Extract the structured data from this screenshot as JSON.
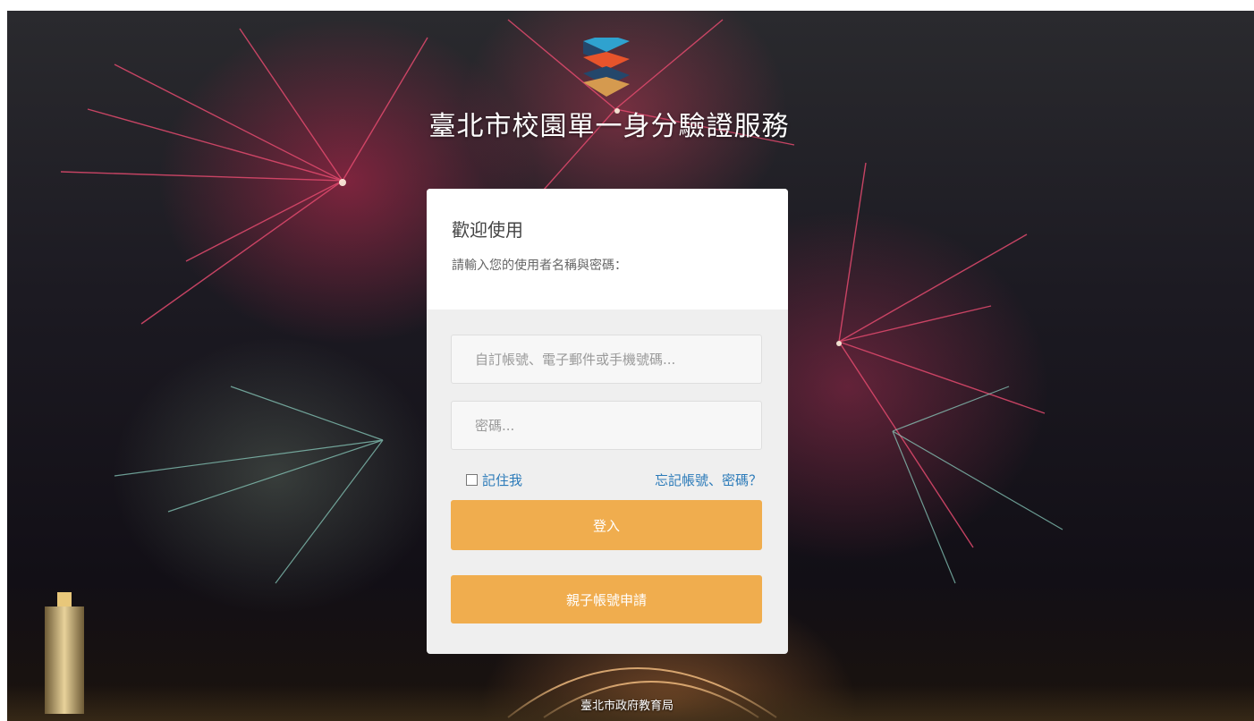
{
  "app": {
    "title": "臺北市校園單一身分驗證服務"
  },
  "login_card": {
    "heading": "歡迎使用",
    "subheading": "請輸入您的使用者名稱與密碼：",
    "account_placeholder": "自訂帳號、電子郵件或手機號碼...",
    "password_placeholder": "密碼...",
    "remember_label": "記住我",
    "forgot_link": "忘記帳號、密碼？",
    "login_button": "登入",
    "parent_account_button": "親子帳號申請"
  },
  "footer": {
    "text": "臺北市政府教育局"
  },
  "colors": {
    "button_accent": "#f0ad4e",
    "link": "#2c7bb9",
    "logo_blue": "#2fa2cf",
    "logo_orange": "#e8542b",
    "logo_navy": "#24476b",
    "logo_tan": "#d59a4f"
  },
  "icons": {
    "logo": "layered-chevron-logo",
    "checkbox": "checkbox-unchecked"
  }
}
